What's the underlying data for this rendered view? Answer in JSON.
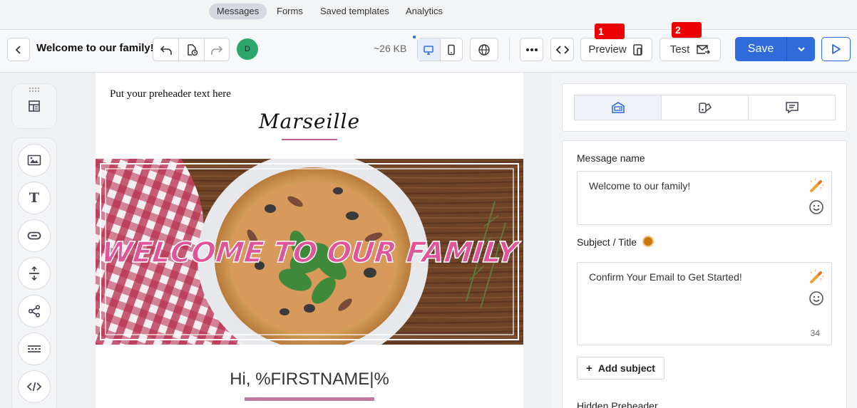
{
  "nav": {
    "items": [
      {
        "label": "Messages",
        "active": true
      },
      {
        "label": "Forms",
        "active": false
      },
      {
        "label": "Saved templates",
        "active": false
      },
      {
        "label": "Analytics",
        "active": false
      }
    ]
  },
  "toolbar": {
    "title": "Welcome to our family!",
    "avatar_initial": "D",
    "size": "~26 KB",
    "preview_label": "Preview",
    "test_label": "Test",
    "save_label": "Save",
    "marker_1": "1",
    "marker_2": "2"
  },
  "email": {
    "preheader": "Put your preheader text here",
    "brand": "Marseille",
    "hero_text": "WELCOME TO OUR FAMILY",
    "greeting": "Hi, %FIRSTNAME|%"
  },
  "panel": {
    "message_name_label": "Message name",
    "message_name_value": "Welcome to our family!",
    "subject_label": "Subject / Title",
    "subject_value": "Confirm Your Email to Get Started!",
    "subject_count": "34",
    "add_subject_label": "Add subject",
    "hidden_preheader_label": "Hidden Preheader"
  },
  "colors": {
    "accent": "#2f6bd9",
    "marker": "#ee0000",
    "avatar": "#2aa66a",
    "hero_text": "#e0559a"
  }
}
